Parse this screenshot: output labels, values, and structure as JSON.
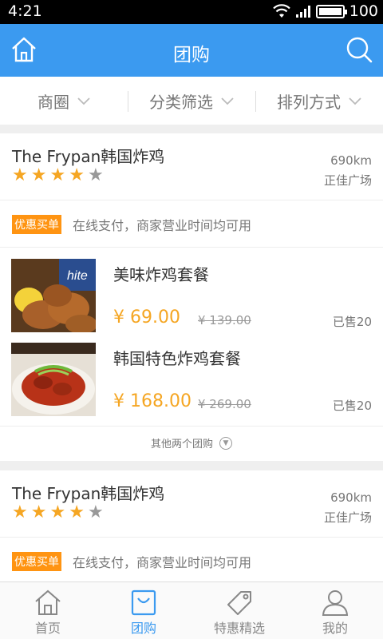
{
  "status": {
    "time": "4:21",
    "battery": "100",
    "battery_level": 1.0
  },
  "nav": {
    "title": "团购",
    "home_icon": "home-icon",
    "search_icon": "search-icon"
  },
  "filters": [
    {
      "label": "商圈"
    },
    {
      "label": "分类筛选"
    },
    {
      "label": "排列方式"
    }
  ],
  "shops": [
    {
      "name": "The Frypan韩国炸鸡",
      "rating": 4,
      "max_rating": 5,
      "distance": "690km",
      "area": "正佳广场",
      "promo_badge": "优惠买单",
      "promo_text": "在线支付，商家营业时间均可用",
      "deals": [
        {
          "name": "美味炸鸡套餐",
          "price": "¥ 69.00",
          "original": "¥ 139.00",
          "sold": "已售20"
        },
        {
          "name": "韩国特色炸鸡套餐",
          "price": "¥ 168.00",
          "original": "¥ 269.00",
          "sold": "已售20"
        }
      ],
      "more_label": "其他两个团购"
    },
    {
      "name": "The Frypan韩国炸鸡",
      "rating": 4,
      "max_rating": 5,
      "distance": "690km",
      "area": "正佳广场",
      "promo_badge": "优惠买单",
      "promo_text": "在线支付，商家营业时间均可用"
    }
  ],
  "tabs": [
    {
      "label": "首页",
      "icon": "home-icon",
      "active": false
    },
    {
      "label": "团购",
      "icon": "shopping-bag-icon",
      "active": true
    },
    {
      "label": "特惠精选",
      "icon": "tag-icon",
      "active": false
    },
    {
      "label": "我的",
      "icon": "user-icon",
      "active": false
    }
  ],
  "colors": {
    "primary": "#3b9af0",
    "accent": "#f5a623",
    "badge": "#ff9412"
  }
}
